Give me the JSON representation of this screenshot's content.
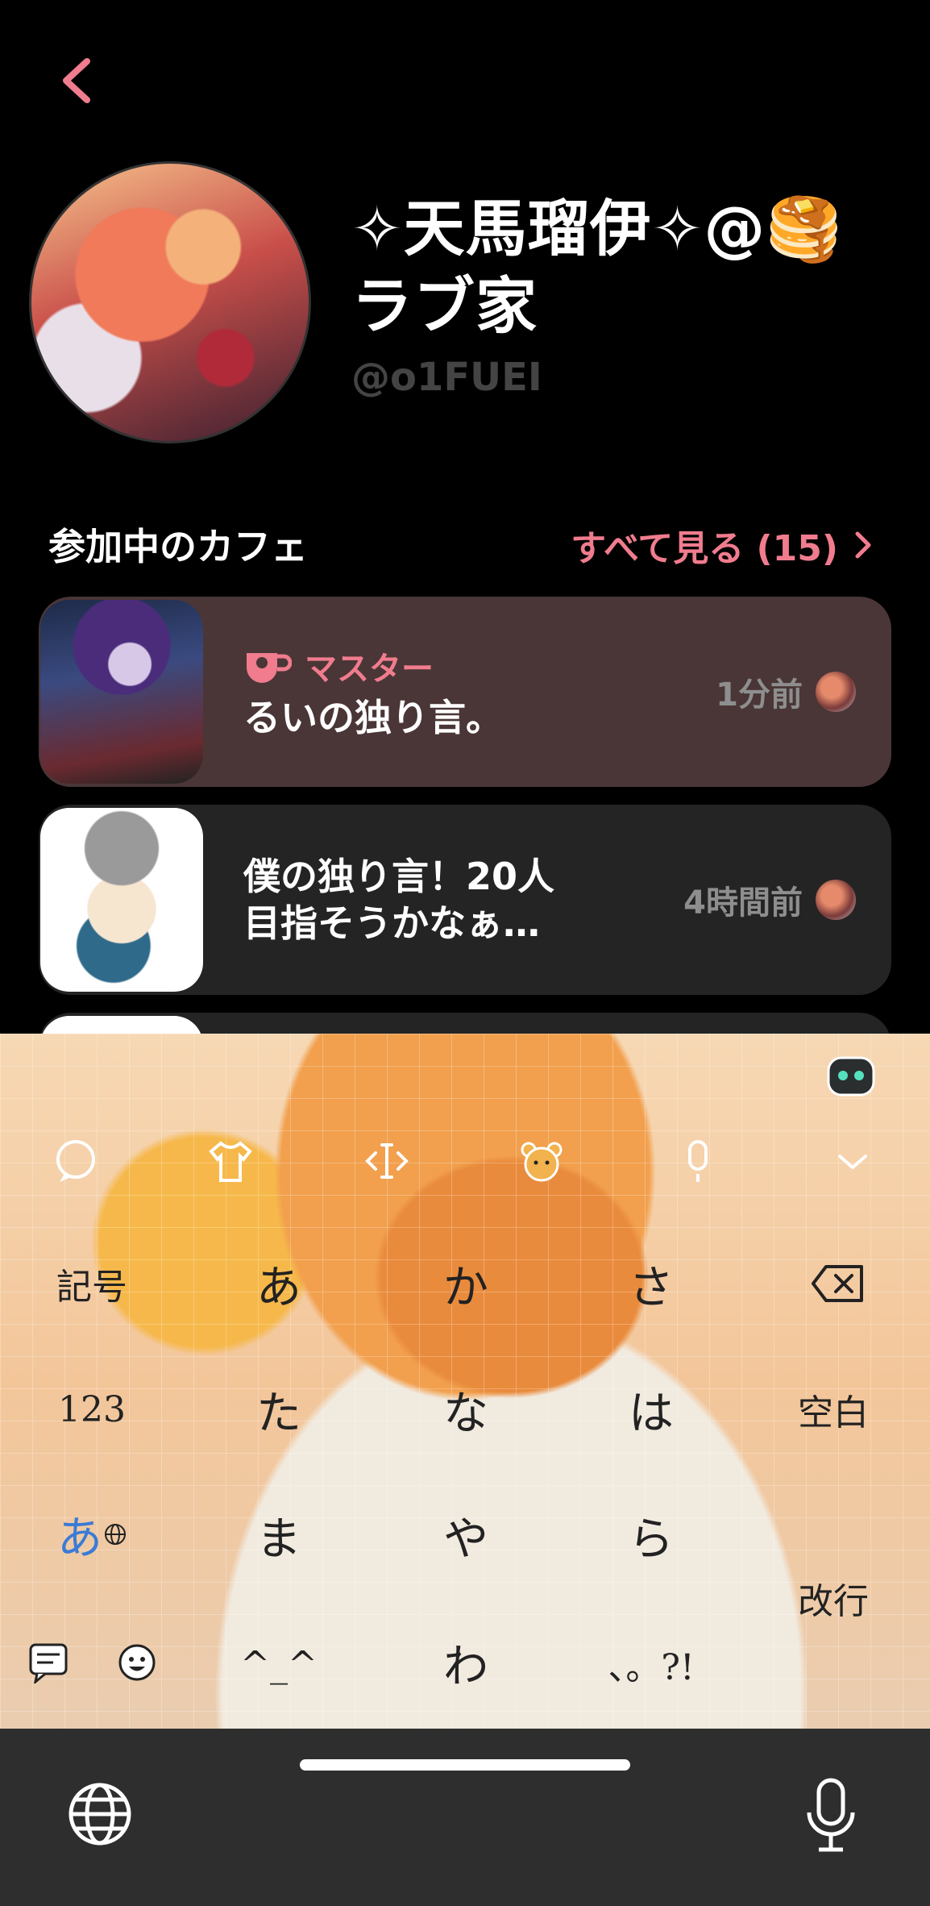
{
  "profile": {
    "name": "✧天馬瑠伊✧@🥞ラブ家",
    "handle": "@o1FUEI"
  },
  "cafes_section": {
    "title": "参加中のカフェ",
    "see_all": "すべて見る (15)"
  },
  "cafes": [
    {
      "role": "マスター",
      "title": "るいの独り言。",
      "time": "1分前"
    },
    {
      "title_line1": "僕の独り言！20人",
      "title_line2": "目指そうかなぁ…",
      "time": "4時間前"
    }
  ],
  "keyboard": {
    "keys": {
      "symbols": "記号",
      "a": "あ",
      "ka": "か",
      "sa": "さ",
      "num": "123",
      "ta": "た",
      "na": "な",
      "ha": "は",
      "space": "空白",
      "mode": "あ",
      "ma": "ま",
      "ya": "や",
      "ra": "ら",
      "enter": "改行",
      "kaomoji": "^_^",
      "wa": "わ",
      "punct": "、。?!"
    }
  },
  "colors": {
    "accent": "#f07c8e",
    "card_active": "#4a3636",
    "card_normal": "#242424",
    "handle": "#444444"
  }
}
